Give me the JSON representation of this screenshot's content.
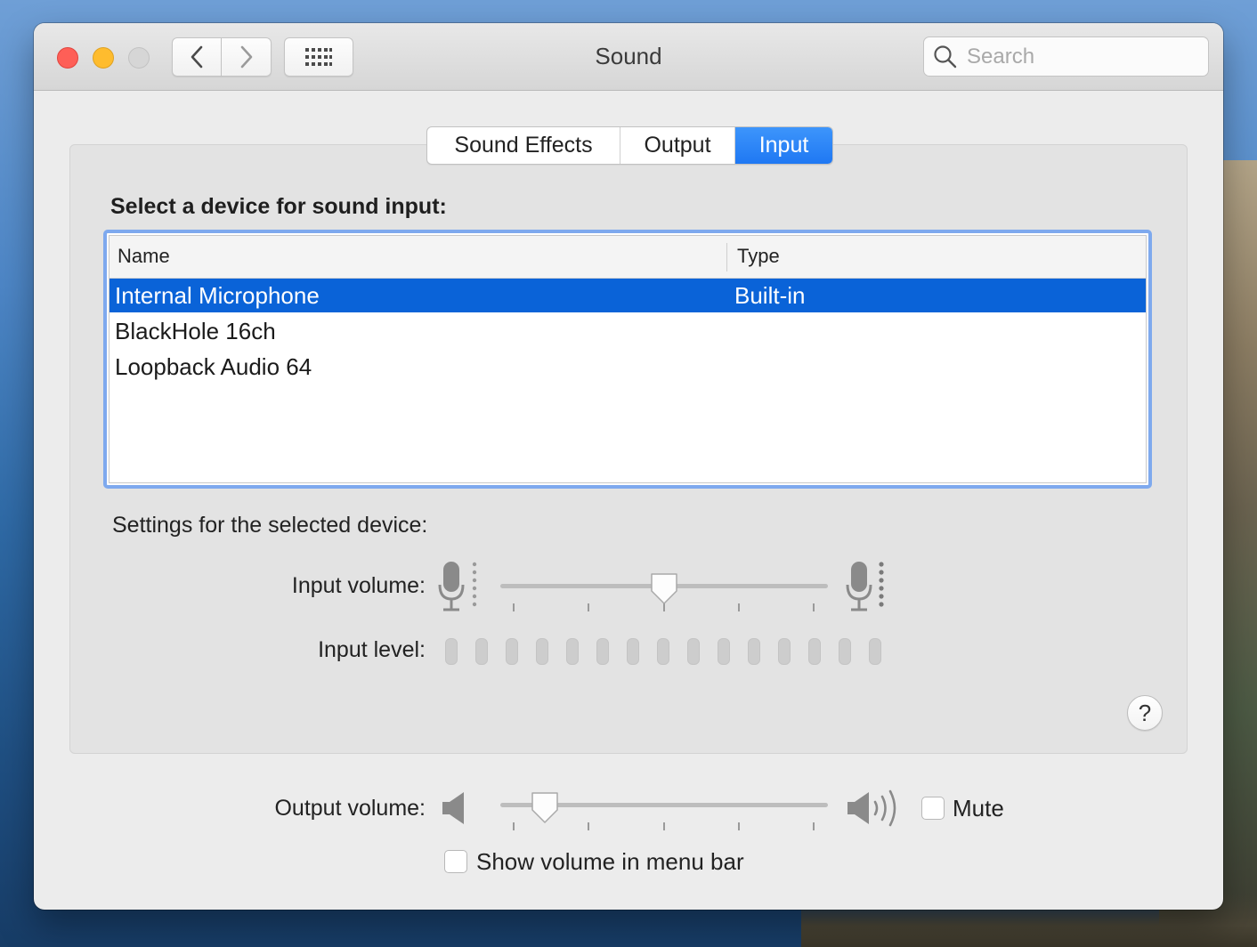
{
  "window": {
    "title": "Sound"
  },
  "search": {
    "placeholder": "Search"
  },
  "tabs": [
    {
      "label": "Sound Effects",
      "active": false
    },
    {
      "label": "Output",
      "active": false
    },
    {
      "label": "Input",
      "active": true
    }
  ],
  "input_panel": {
    "heading": "Select a device for sound input:",
    "columns": {
      "name": "Name",
      "type": "Type"
    },
    "devices": [
      {
        "name": "Internal Microphone",
        "type": "Built-in",
        "selected": true
      },
      {
        "name": "BlackHole 16ch",
        "type": "",
        "selected": false
      },
      {
        "name": "Loopback Audio 64",
        "type": "",
        "selected": false
      }
    ],
    "settings_label": "Settings for the selected device:",
    "input_volume_label": "Input volume:",
    "input_volume_value": 0.5,
    "input_level_label": "Input level:",
    "input_level_segments": 15,
    "input_level_active": 0
  },
  "output": {
    "volume_label": "Output volume:",
    "volume_value": 0.1,
    "mute_label": "Mute",
    "mute_checked": false,
    "show_volume_label": "Show volume in menu bar",
    "show_volume_checked": false
  },
  "help": {
    "label": "?"
  },
  "colors": {
    "accent": "#1f78f3",
    "selection": "#0a63d8",
    "focus_ring": "#7ea9ee"
  }
}
